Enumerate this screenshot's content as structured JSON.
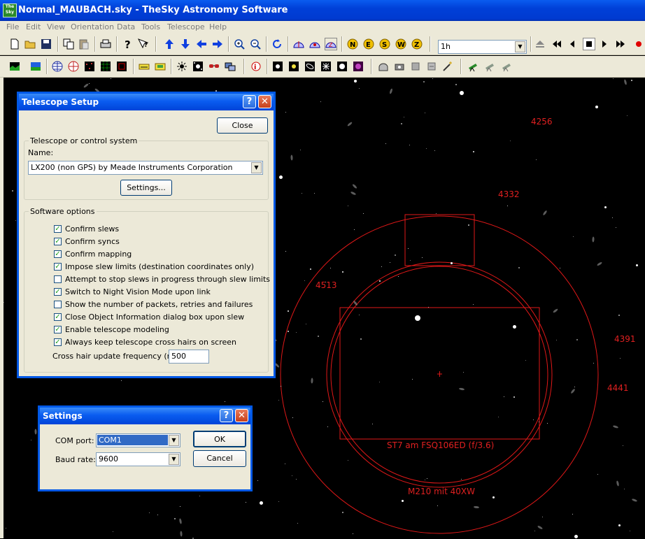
{
  "window": {
    "title": "Normal_MAUBACH.sky - TheSky Astronomy Software",
    "icon_text": "The Sky"
  },
  "menu": [
    "File",
    "Edit",
    "View",
    "Orientation",
    "Data",
    "Tools",
    "Telescope",
    "Help"
  ],
  "toolbar": {
    "time_step": "1h"
  },
  "telescope_setup": {
    "title": "Telescope Setup",
    "close_label": "Close",
    "group_telescope": "Telescope or control system",
    "name_label": "Name:",
    "name_value": "LX200 (non GPS) by Meade Instruments Corporation",
    "settings_label": "Settings...",
    "group_software": "Software options",
    "options": [
      {
        "label": "Confirm slews",
        "checked": true
      },
      {
        "label": "Confirm syncs",
        "checked": true
      },
      {
        "label": "Confirm mapping",
        "checked": true
      },
      {
        "label": "Impose slew limits (destination coordinates only)",
        "checked": true
      },
      {
        "label": "Attempt to stop slews in progress through slew limits",
        "checked": false
      },
      {
        "label": "Switch to Night Vision Mode upon link",
        "checked": true
      },
      {
        "label": "Show the number of packets, retries and failures",
        "checked": false
      },
      {
        "label": "Close Object Information dialog box upon slew",
        "checked": true
      },
      {
        "label": "Enable telescope modeling",
        "checked": true
      },
      {
        "label": "Always keep telescope cross hairs on screen",
        "checked": true
      }
    ],
    "crosshair_label": "Cross hair update frequency (ms):",
    "crosshair_value": "500"
  },
  "settings_dialog": {
    "title": "Settings",
    "com_label": "COM port:",
    "com_value": "COM1",
    "baud_label": "Baud rate:",
    "baud_value": "9600",
    "ok_label": "OK",
    "cancel_label": "Cancel"
  },
  "sky_labels": {
    "ngc4256": "4256",
    "ngc4332": "4332",
    "ngc4513": "4513",
    "ngc4391": "4391",
    "ngc4441": "4441",
    "fov_ccd": "ST7 am FSQ106ED (f/3.6)",
    "fov_eyepiece": "M210 mit 40XW"
  }
}
